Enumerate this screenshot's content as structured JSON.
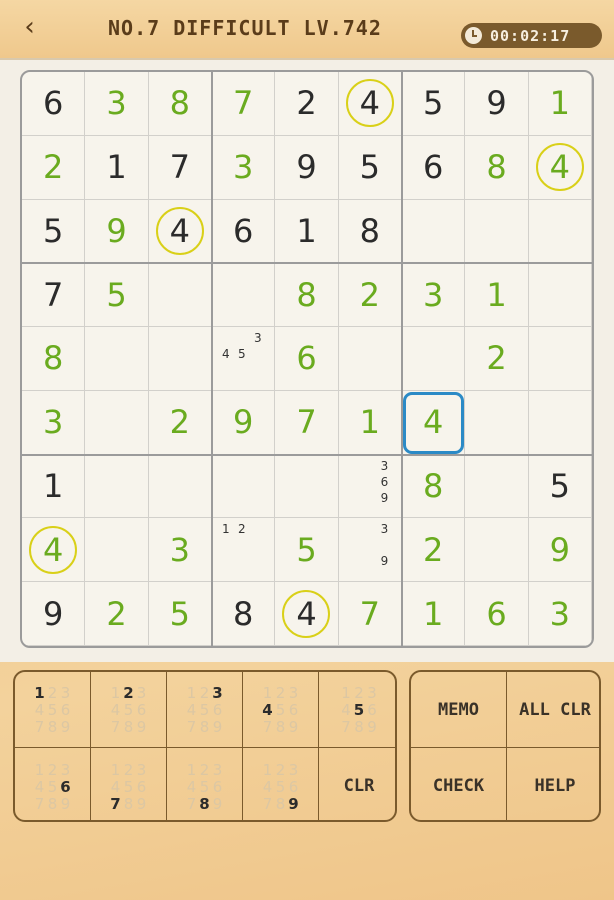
{
  "header": {
    "back_icon": "chevron-left-icon",
    "title": "NO.7 DIFFICULT LV.742",
    "timer_icon": "clock-icon",
    "timer": "00:02:17"
  },
  "colors": {
    "given": "#2b2b2b",
    "user": "#6aab1f",
    "highlight": "#d9d018",
    "selection": "#2b8ac6",
    "wood_dark": "#7a5a2c"
  },
  "board": {
    "selected": [
      5,
      6
    ],
    "cells": [
      [
        {
          "v": "6",
          "t": "g"
        },
        {
          "v": "3",
          "t": "u"
        },
        {
          "v": "8",
          "t": "u"
        },
        {
          "v": "7",
          "t": "u"
        },
        {
          "v": "2",
          "t": "g"
        },
        {
          "v": "4",
          "t": "g",
          "h": 1
        },
        {
          "v": "5",
          "t": "g"
        },
        {
          "v": "9",
          "t": "g"
        },
        {
          "v": "1",
          "t": "u"
        }
      ],
      [
        {
          "v": "2",
          "t": "u"
        },
        {
          "v": "1",
          "t": "g"
        },
        {
          "v": "7",
          "t": "g"
        },
        {
          "v": "3",
          "t": "u"
        },
        {
          "v": "9",
          "t": "g"
        },
        {
          "v": "5",
          "t": "g"
        },
        {
          "v": "6",
          "t": "g"
        },
        {
          "v": "8",
          "t": "u"
        },
        {
          "v": "4",
          "t": "u",
          "h": 1
        }
      ],
      [
        {
          "v": "5",
          "t": "g"
        },
        {
          "v": "9",
          "t": "u"
        },
        {
          "v": "4",
          "t": "g",
          "h": 1
        },
        {
          "v": "6",
          "t": "g"
        },
        {
          "v": "1",
          "t": "g"
        },
        {
          "v": "8",
          "t": "g"
        },
        {
          "v": ""
        },
        {
          "v": ""
        },
        {
          "v": ""
        }
      ],
      [
        {
          "v": "7",
          "t": "g"
        },
        {
          "v": "5",
          "t": "u"
        },
        {
          "v": ""
        },
        {
          "v": ""
        },
        {
          "v": "8",
          "t": "u"
        },
        {
          "v": "2",
          "t": "u"
        },
        {
          "v": "3",
          "t": "u"
        },
        {
          "v": "1",
          "t": "u"
        },
        {
          "v": ""
        }
      ],
      [
        {
          "v": "8",
          "t": "u"
        },
        {
          "v": ""
        },
        {
          "v": ""
        },
        {
          "v": "",
          "m": [
            "3",
            "4",
            "5"
          ]
        },
        {
          "v": "6",
          "t": "u"
        },
        {
          "v": ""
        },
        {
          "v": ""
        },
        {
          "v": "2",
          "t": "u"
        },
        {
          "v": ""
        }
      ],
      [
        {
          "v": "3",
          "t": "u"
        },
        {
          "v": ""
        },
        {
          "v": "2",
          "t": "u"
        },
        {
          "v": "9",
          "t": "u"
        },
        {
          "v": "7",
          "t": "u"
        },
        {
          "v": "1",
          "t": "u"
        },
        {
          "v": "4",
          "t": "u"
        },
        {
          "v": ""
        },
        {
          "v": ""
        }
      ],
      [
        {
          "v": "1",
          "t": "g"
        },
        {
          "v": ""
        },
        {
          "v": ""
        },
        {
          "v": ""
        },
        {
          "v": ""
        },
        {
          "v": "",
          "m": [
            "3",
            "6",
            "9"
          ]
        },
        {
          "v": "8",
          "t": "u"
        },
        {
          "v": ""
        },
        {
          "v": "5",
          "t": "g"
        }
      ],
      [
        {
          "v": "4",
          "t": "u",
          "h": 1
        },
        {
          "v": ""
        },
        {
          "v": "3",
          "t": "u"
        },
        {
          "v": "",
          "m": [
            "1",
            "2"
          ]
        },
        {
          "v": "5",
          "t": "u"
        },
        {
          "v": "",
          "m": [
            "3",
            "9"
          ]
        },
        {
          "v": "2",
          "t": "u"
        },
        {
          "v": ""
        },
        {
          "v": "9",
          "t": "u"
        }
      ],
      [
        {
          "v": "9",
          "t": "g"
        },
        {
          "v": "2",
          "t": "u"
        },
        {
          "v": "5",
          "t": "u"
        },
        {
          "v": "8",
          "t": "g"
        },
        {
          "v": "4",
          "t": "g",
          "h": 1
        },
        {
          "v": "7",
          "t": "u"
        },
        {
          "v": "1",
          "t": "u"
        },
        {
          "v": "6",
          "t": "u"
        },
        {
          "v": "3",
          "t": "u"
        }
      ]
    ]
  },
  "keypad": {
    "numbers": [
      "1",
      "2",
      "3",
      "4",
      "5",
      "6",
      "7",
      "8",
      "9"
    ],
    "clear_label": "CLR"
  },
  "actions": {
    "memo": "MEMO",
    "all_clear": "ALL CLR",
    "check": "CHECK",
    "help": "HELP"
  }
}
